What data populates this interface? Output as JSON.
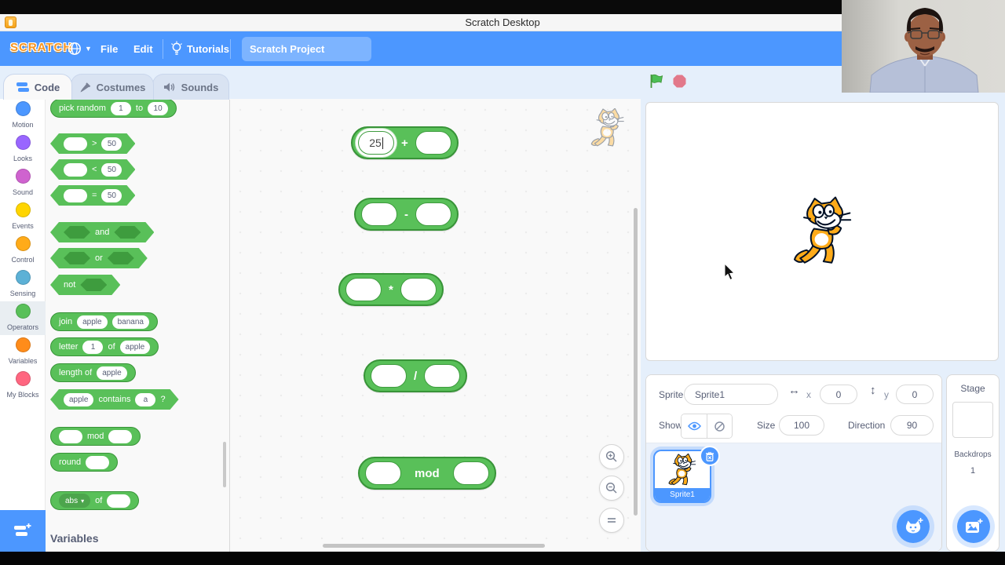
{
  "window": {
    "title": "Scratch Desktop"
  },
  "menu": {
    "logo": "SCRATCH",
    "file": "File",
    "edit": "Edit",
    "tutorials": "Tutorials",
    "project_name": "Scratch Project"
  },
  "tabs": [
    {
      "label": "Code",
      "active": true
    },
    {
      "label": "Costumes",
      "active": false
    },
    {
      "label": "Sounds",
      "active": false
    }
  ],
  "categories": [
    {
      "name": "Motion",
      "color": "#4C97FF",
      "selected": false
    },
    {
      "name": "Looks",
      "color": "#9966FF",
      "selected": false
    },
    {
      "name": "Sound",
      "color": "#CF63CF",
      "selected": false
    },
    {
      "name": "Events",
      "color": "#FFD500",
      "selected": false
    },
    {
      "name": "Control",
      "color": "#FFAB19",
      "selected": false
    },
    {
      "name": "Sensing",
      "color": "#5CB1D6",
      "selected": false
    },
    {
      "name": "Operators",
      "color": "#59C059",
      "selected": true
    },
    {
      "name": "Variables",
      "color": "#FF8C1A",
      "selected": false
    },
    {
      "name": "My Blocks",
      "color": "#FF6680",
      "selected": false
    }
  ],
  "palette": {
    "category": "Operators",
    "section_heading": "Variables",
    "blocks": [
      {
        "shape": "round",
        "parts": [
          {
            "t": "label",
            "v": "pick random"
          },
          {
            "t": "value",
            "v": "1"
          },
          {
            "t": "label",
            "v": "to"
          },
          {
            "t": "value",
            "v": "10"
          }
        ]
      },
      {
        "shape": "hex",
        "parts": [
          {
            "t": "slot"
          },
          {
            "t": "label",
            "v": ">"
          },
          {
            "t": "value",
            "v": "50"
          }
        ]
      },
      {
        "shape": "hex",
        "parts": [
          {
            "t": "slot"
          },
          {
            "t": "label",
            "v": "<"
          },
          {
            "t": "value",
            "v": "50"
          }
        ]
      },
      {
        "shape": "hex",
        "parts": [
          {
            "t": "slot"
          },
          {
            "t": "label",
            "v": "="
          },
          {
            "t": "value",
            "v": "50"
          }
        ]
      },
      {
        "shape": "hex",
        "parts": [
          {
            "t": "hexslot"
          },
          {
            "t": "label",
            "v": "and"
          },
          {
            "t": "hexslot"
          }
        ]
      },
      {
        "shape": "hex",
        "parts": [
          {
            "t": "hexslot"
          },
          {
            "t": "label",
            "v": "or"
          },
          {
            "t": "hexslot"
          }
        ]
      },
      {
        "shape": "hex",
        "parts": [
          {
            "t": "label",
            "v": "not"
          },
          {
            "t": "hexslot"
          }
        ]
      },
      {
        "shape": "round",
        "parts": [
          {
            "t": "label",
            "v": "join"
          },
          {
            "t": "value",
            "v": "apple"
          },
          {
            "t": "value",
            "v": "banana"
          }
        ]
      },
      {
        "shape": "round",
        "parts": [
          {
            "t": "label",
            "v": "letter"
          },
          {
            "t": "value",
            "v": "1"
          },
          {
            "t": "label",
            "v": "of"
          },
          {
            "t": "value",
            "v": "apple"
          }
        ]
      },
      {
        "shape": "round",
        "parts": [
          {
            "t": "label",
            "v": "length of"
          },
          {
            "t": "value",
            "v": "apple"
          }
        ]
      },
      {
        "shape": "hex",
        "parts": [
          {
            "t": "value",
            "v": "apple"
          },
          {
            "t": "label",
            "v": "contains"
          },
          {
            "t": "value",
            "v": "a"
          },
          {
            "t": "label",
            "v": "?"
          }
        ]
      },
      {
        "shape": "round",
        "parts": [
          {
            "t": "slot"
          },
          {
            "t": "label",
            "v": "mod"
          },
          {
            "t": "slot"
          }
        ]
      },
      {
        "shape": "round",
        "parts": [
          {
            "t": "label",
            "v": "round"
          },
          {
            "t": "slot"
          }
        ]
      },
      {
        "shape": "round",
        "parts": [
          {
            "t": "dropdown",
            "v": "abs"
          },
          {
            "t": "label",
            "v": "of"
          },
          {
            "t": "slot"
          }
        ]
      }
    ]
  },
  "canvas": {
    "blocks": [
      {
        "op": "+",
        "slots": [
          {
            "value": "25",
            "active": true
          },
          {}
        ]
      },
      {
        "op": "-",
        "slots": [
          {},
          {}
        ]
      },
      {
        "op": "*",
        "slots": [
          {},
          {}
        ]
      },
      {
        "op": "/",
        "slots": [
          {},
          {}
        ]
      },
      {
        "op": "mod",
        "slots": [
          {},
          {}
        ]
      }
    ]
  },
  "sprite_panel": {
    "sprite_label": "Sprite",
    "sprite_name": "Sprite1",
    "x_label": "x",
    "x_value": "0",
    "y_label": "y",
    "y_value": "0",
    "show_label": "Show",
    "size_label": "Size",
    "size_value": "100",
    "direction_label": "Direction",
    "direction_value": "90"
  },
  "sprite_list": {
    "items": [
      {
        "name": "Sprite1",
        "selected": true
      }
    ]
  },
  "stage_panel": {
    "title": "Stage",
    "backdrops_label": "Backdrops",
    "backdrops_count": "1"
  },
  "colors": {
    "brand_blue": "#4C97FF",
    "operators_green": "#59C059",
    "operators_border": "#389438",
    "flag_green": "#4CBF56",
    "stop_red": "#E2788A",
    "ui_text": "#575E75"
  },
  "icons": {
    "app": "scratch-app-icon",
    "language": "globe-icon",
    "language_caret": "chevron-down-icon",
    "tutorials": "lightbulb-icon",
    "code_tab": "blocks-icon",
    "costumes_tab": "brush-icon",
    "sounds_tab": "speaker-icon",
    "run": "green-flag-icon",
    "stop": "stop-sign-icon",
    "x_position": "left-right-arrow-icon",
    "y_position": "up-down-arrow-icon",
    "show_on": "eye-open-icon",
    "show_off": "eye-slash-icon",
    "delete_sprite": "trash-x-icon",
    "add_sprite": "cat-plus-icon",
    "add_backdrop": "image-plus-icon",
    "add_extension": "extension-blocks-icon",
    "zoom_in": "magnifier-plus-icon",
    "zoom_out": "magnifier-minus-icon",
    "zoom_reset": "equals-icon",
    "stage_sprite": "scratch-cat",
    "pointer": "mouse-cursor",
    "webcam": "webcam-overlay"
  }
}
